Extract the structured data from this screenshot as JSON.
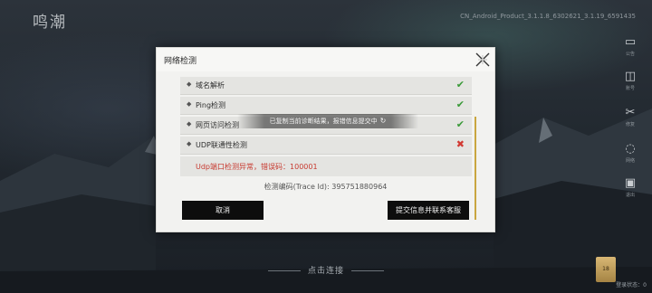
{
  "background": {
    "logo_text": "鸣潮",
    "version": "CN_Android_Product_3.1.1.8_6302621_3.1.19_6591435",
    "side_icons": [
      {
        "icon": "announcement-icon",
        "caption": "公告",
        "glyph": "▭"
      },
      {
        "icon": "account-icon",
        "caption": "账号",
        "glyph": "◫"
      },
      {
        "icon": "repair-icon",
        "caption": "修复",
        "glyph": "✂"
      },
      {
        "icon": "network-icon",
        "caption": "网络",
        "glyph": "◌"
      },
      {
        "icon": "exit-icon",
        "caption": "退出",
        "glyph": "▣"
      }
    ],
    "bottom_hint": "点击连接",
    "login_status": "登录状态：0",
    "badge_text": "18"
  },
  "dialog": {
    "title": "网络检测",
    "items": [
      {
        "label": "域名解析",
        "status": "ok",
        "symbol": "✔"
      },
      {
        "label": "Ping检测",
        "status": "ok",
        "symbol": "✔"
      },
      {
        "label": "网页访问检测",
        "status": "ok",
        "symbol": "✔"
      },
      {
        "label": "UDP联通性检测",
        "status": "fail",
        "symbol": "✖"
      }
    ],
    "bullet": "◆",
    "error_message": "Udp端口检测异常，错误码：100001",
    "trace": "检测编码(Trace Id): 395751880964",
    "cancel_label": "取消",
    "submit_label": "提交信息并联系客服"
  },
  "toast": {
    "text": "已复制当前诊断结果，报错信息提交中",
    "spinner": "↻"
  },
  "colors": {
    "ok": "#3a9a38",
    "fail": "#d23a33",
    "error_text": "#c73a30",
    "scroll_thumb": "#c9a640",
    "button_bg": "#0d0d0d"
  }
}
